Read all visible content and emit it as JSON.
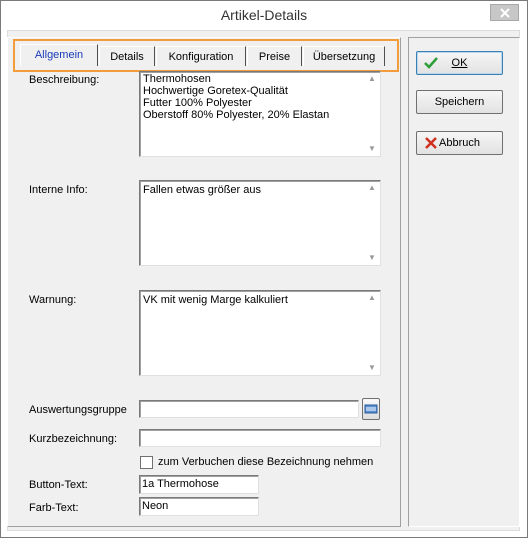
{
  "window": {
    "title": "Artikel-Details"
  },
  "tabs": [
    {
      "label": "Allgemein",
      "active": true
    },
    {
      "label": "Details"
    },
    {
      "label": "Konfiguration"
    },
    {
      "label": "Preise"
    },
    {
      "label": "Übersetzung"
    }
  ],
  "form": {
    "beschreibung": {
      "label": "Beschreibung:",
      "lines": [
        "Thermohosen",
        "Hochwertige Goretex-Qualität",
        "Futter 100% Polyester",
        "Oberstoff 80% Polyester, 20% Elastan"
      ]
    },
    "interne_info": {
      "label": "Interne Info:",
      "value": "Fallen etwas größer aus"
    },
    "warnung": {
      "label": "Warnung:",
      "value": "VK mit wenig Marge kalkuliert"
    },
    "auswertungsgruppe": {
      "label": "Auswertungsgruppe",
      "value": ""
    },
    "kurzbezeichnung": {
      "label": "Kurzbezeichnung:",
      "value": ""
    },
    "checkbox": {
      "label": "zum Verbuchen diese Bezeichnung nehmen",
      "checked": false
    },
    "button_text": {
      "label": "Button-Text:",
      "value": "1a Thermohose"
    },
    "farb_text": {
      "label": "Farb-Text:",
      "value": "Neon"
    }
  },
  "buttons": {
    "ok": "OK",
    "speichern": "Speichern",
    "abbruch": "Abbruch"
  },
  "colors": {
    "active_tab": "#1a3ab8",
    "highlight": "#f39c3c",
    "ok_icon": "#2e9e3a",
    "cancel_icon": "#d03020"
  }
}
